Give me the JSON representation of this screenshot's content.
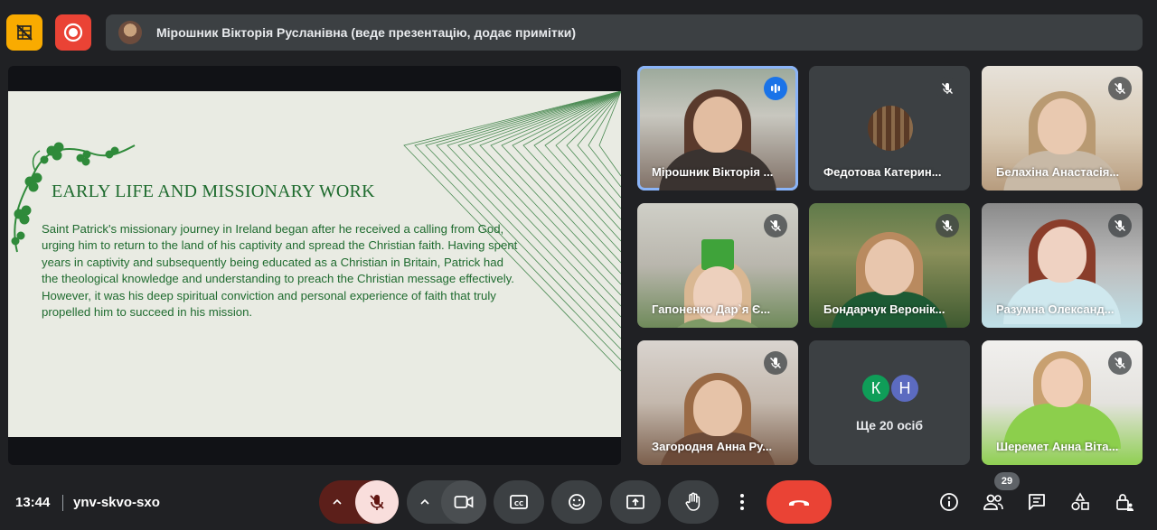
{
  "top_bar": {
    "presenter_text": "Мірошник Вікторія Русланівна (веде презентацію, додає примітки)"
  },
  "slide": {
    "title": "EARLY LIFE AND MISSIONARY WORK",
    "body": "Saint Patrick's missionary journey in Ireland began after he received a calling from God, urging him to return to the land of his captivity and spread the Christian faith. Having spent years in captivity and subsequently being educated as a Christian in Britain, Patrick had the theological knowledge and understanding to preach the Christian message effectively. However, it was his deep spiritual conviction and personal experience of faith that truly propelled him to succeed in his mission.",
    "accent_color": "#1e6b2e"
  },
  "participants": [
    {
      "name": "Мірошник Вікторія ...",
      "muted": false,
      "speaking": true
    },
    {
      "name": "Федотова Катерин...",
      "muted": true
    },
    {
      "name": "Белахіна Анастасія...",
      "muted": true
    },
    {
      "name": "Гапоненко Дар`я Є...",
      "muted": true
    },
    {
      "name": "Бондарчук Веронік...",
      "muted": true
    },
    {
      "name": "Разумна Олександ...",
      "muted": true
    },
    {
      "name": "Загородня Анна Ру...",
      "muted": true
    },
    {
      "name": "Шеремет Анна Віта...",
      "muted": true
    }
  ],
  "more_tile": {
    "avatars": [
      "К",
      "Н"
    ],
    "label": "Ще 20 осіб"
  },
  "bottom_bar": {
    "time": "13:44",
    "meeting_code": "ynv-skvo-sxo",
    "people_count": "29"
  },
  "colors": {
    "background": "#202124",
    "leave_button": "#ea4335",
    "mic_off": "#f9dedc",
    "active_speaker": "#8ab4f8"
  }
}
